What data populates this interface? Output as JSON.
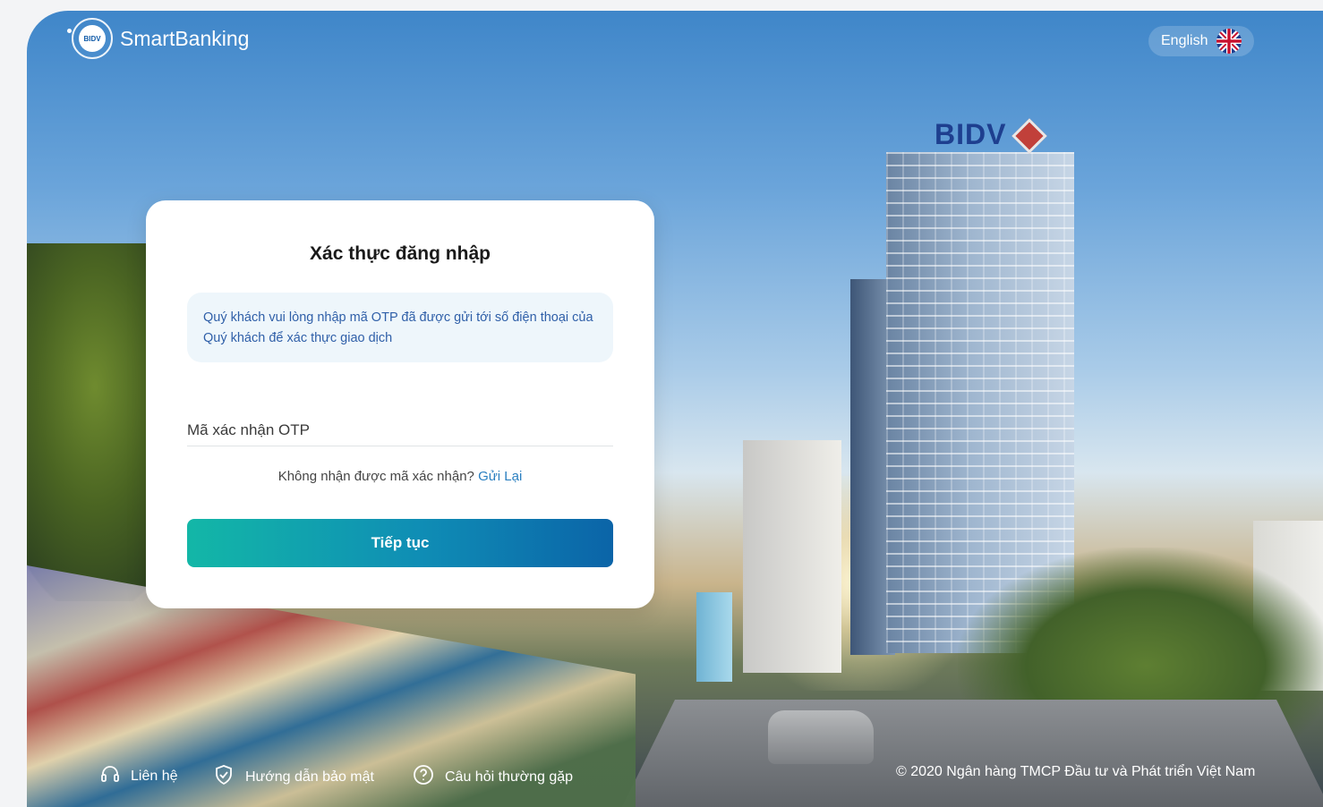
{
  "header": {
    "logo_badge": "BIDV",
    "logo_text": "SmartBanking",
    "language_label": "English",
    "language_flag_icon": "uk-flag-icon"
  },
  "background": {
    "sign_text": "BIDV"
  },
  "card": {
    "title": "Xác thực đăng nhập",
    "notice_text": "Quý khách vui lòng nhập mã OTP đã được gửi tới số điện thoại của Quý khách để xác thực giao dịch",
    "otp_placeholder": "Mã xác nhận OTP",
    "otp_value": "",
    "resend_prompt": "Không nhận được mã xác nhận?",
    "resend_link": "Gửi Lại",
    "submit_label": "Tiếp tục"
  },
  "footer": {
    "links": [
      {
        "label": "Liên hệ",
        "icon": "headset-icon"
      },
      {
        "label": "Hướng dẫn bảo mật",
        "icon": "shield-check-icon"
      },
      {
        "label": "Câu hỏi thường gặp",
        "icon": "help-circle-icon"
      }
    ],
    "copyright": "© 2020 Ngân hàng TMCP Đầu tư và Phát triển Việt Nam"
  },
  "colors": {
    "primary_gradient_start": "#13b7a7",
    "primary_gradient_end": "#0b64a8",
    "link": "#2a7fc0",
    "notice_bg": "#eef6fb"
  }
}
